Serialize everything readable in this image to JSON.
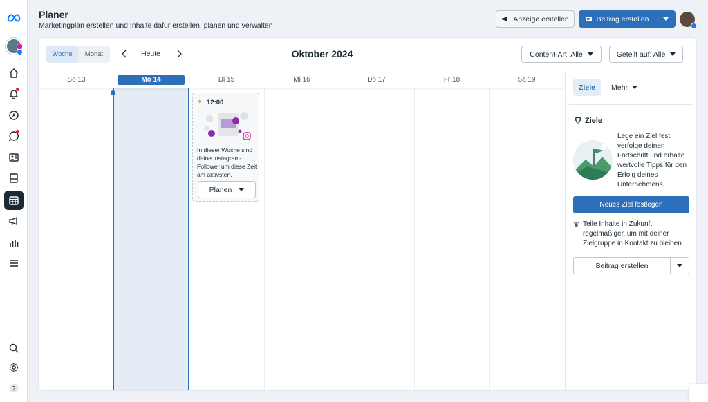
{
  "header": {
    "title": "Planer",
    "subtitle": "Marketingplan erstellen und Inhalte dafür erstellen, planen und verwalten",
    "ad_button": "Anzeige erstellen",
    "post_button": "Beitrag erstellen"
  },
  "toolbar": {
    "view_week": "Woche",
    "view_month": "Monat",
    "today": "Heute",
    "month_title": "Oktober 2024",
    "content_type_filter": "Content-Art: Alle",
    "shared_on_filter": "Geteilt auf: Alle"
  },
  "calendar": {
    "days": [
      "So 13",
      "Mo 14",
      "Di 15",
      "Mi 16",
      "Do 17",
      "Fr 18",
      "Sa 19"
    ],
    "current_day": "Mo 14",
    "tip": {
      "time": "12:00",
      "text": "In dieser Woche sind deine Instagram-Follower um diese Zeit am aktivsten.",
      "button": "Planen"
    }
  },
  "side_panel": {
    "tab_goals": "Ziele",
    "tab_more": "Mehr",
    "goals_heading": "Ziele",
    "goals_text": "Lege ein Ziel fest, verfolge deinen Fortschritt und erhalte wertvolle Tipps für den Erfolg deines Unternehmens.",
    "goals_button": "Neues Ziel festlegen",
    "share_text": "Teile Inhalte in Zukunft regelmäßiger, um mit deiner Zielgruppe in Kontakt zu bleiben.",
    "post_button": "Beitrag erstellen"
  },
  "colors": {
    "primary": "#2d6fba",
    "dark": "#1c2b33",
    "background": "#eef1f6",
    "current_day_column": "#e4ecf5"
  },
  "icons": {
    "rail": [
      "meta-logo-icon",
      "home-icon",
      "bell-icon",
      "compass-icon",
      "chat-icon",
      "id-card-icon",
      "pages-icon",
      "calendar-icon",
      "megaphone-icon",
      "bar-chart-icon",
      "menu-icon",
      "search-icon",
      "gear-icon",
      "help-icon"
    ]
  }
}
